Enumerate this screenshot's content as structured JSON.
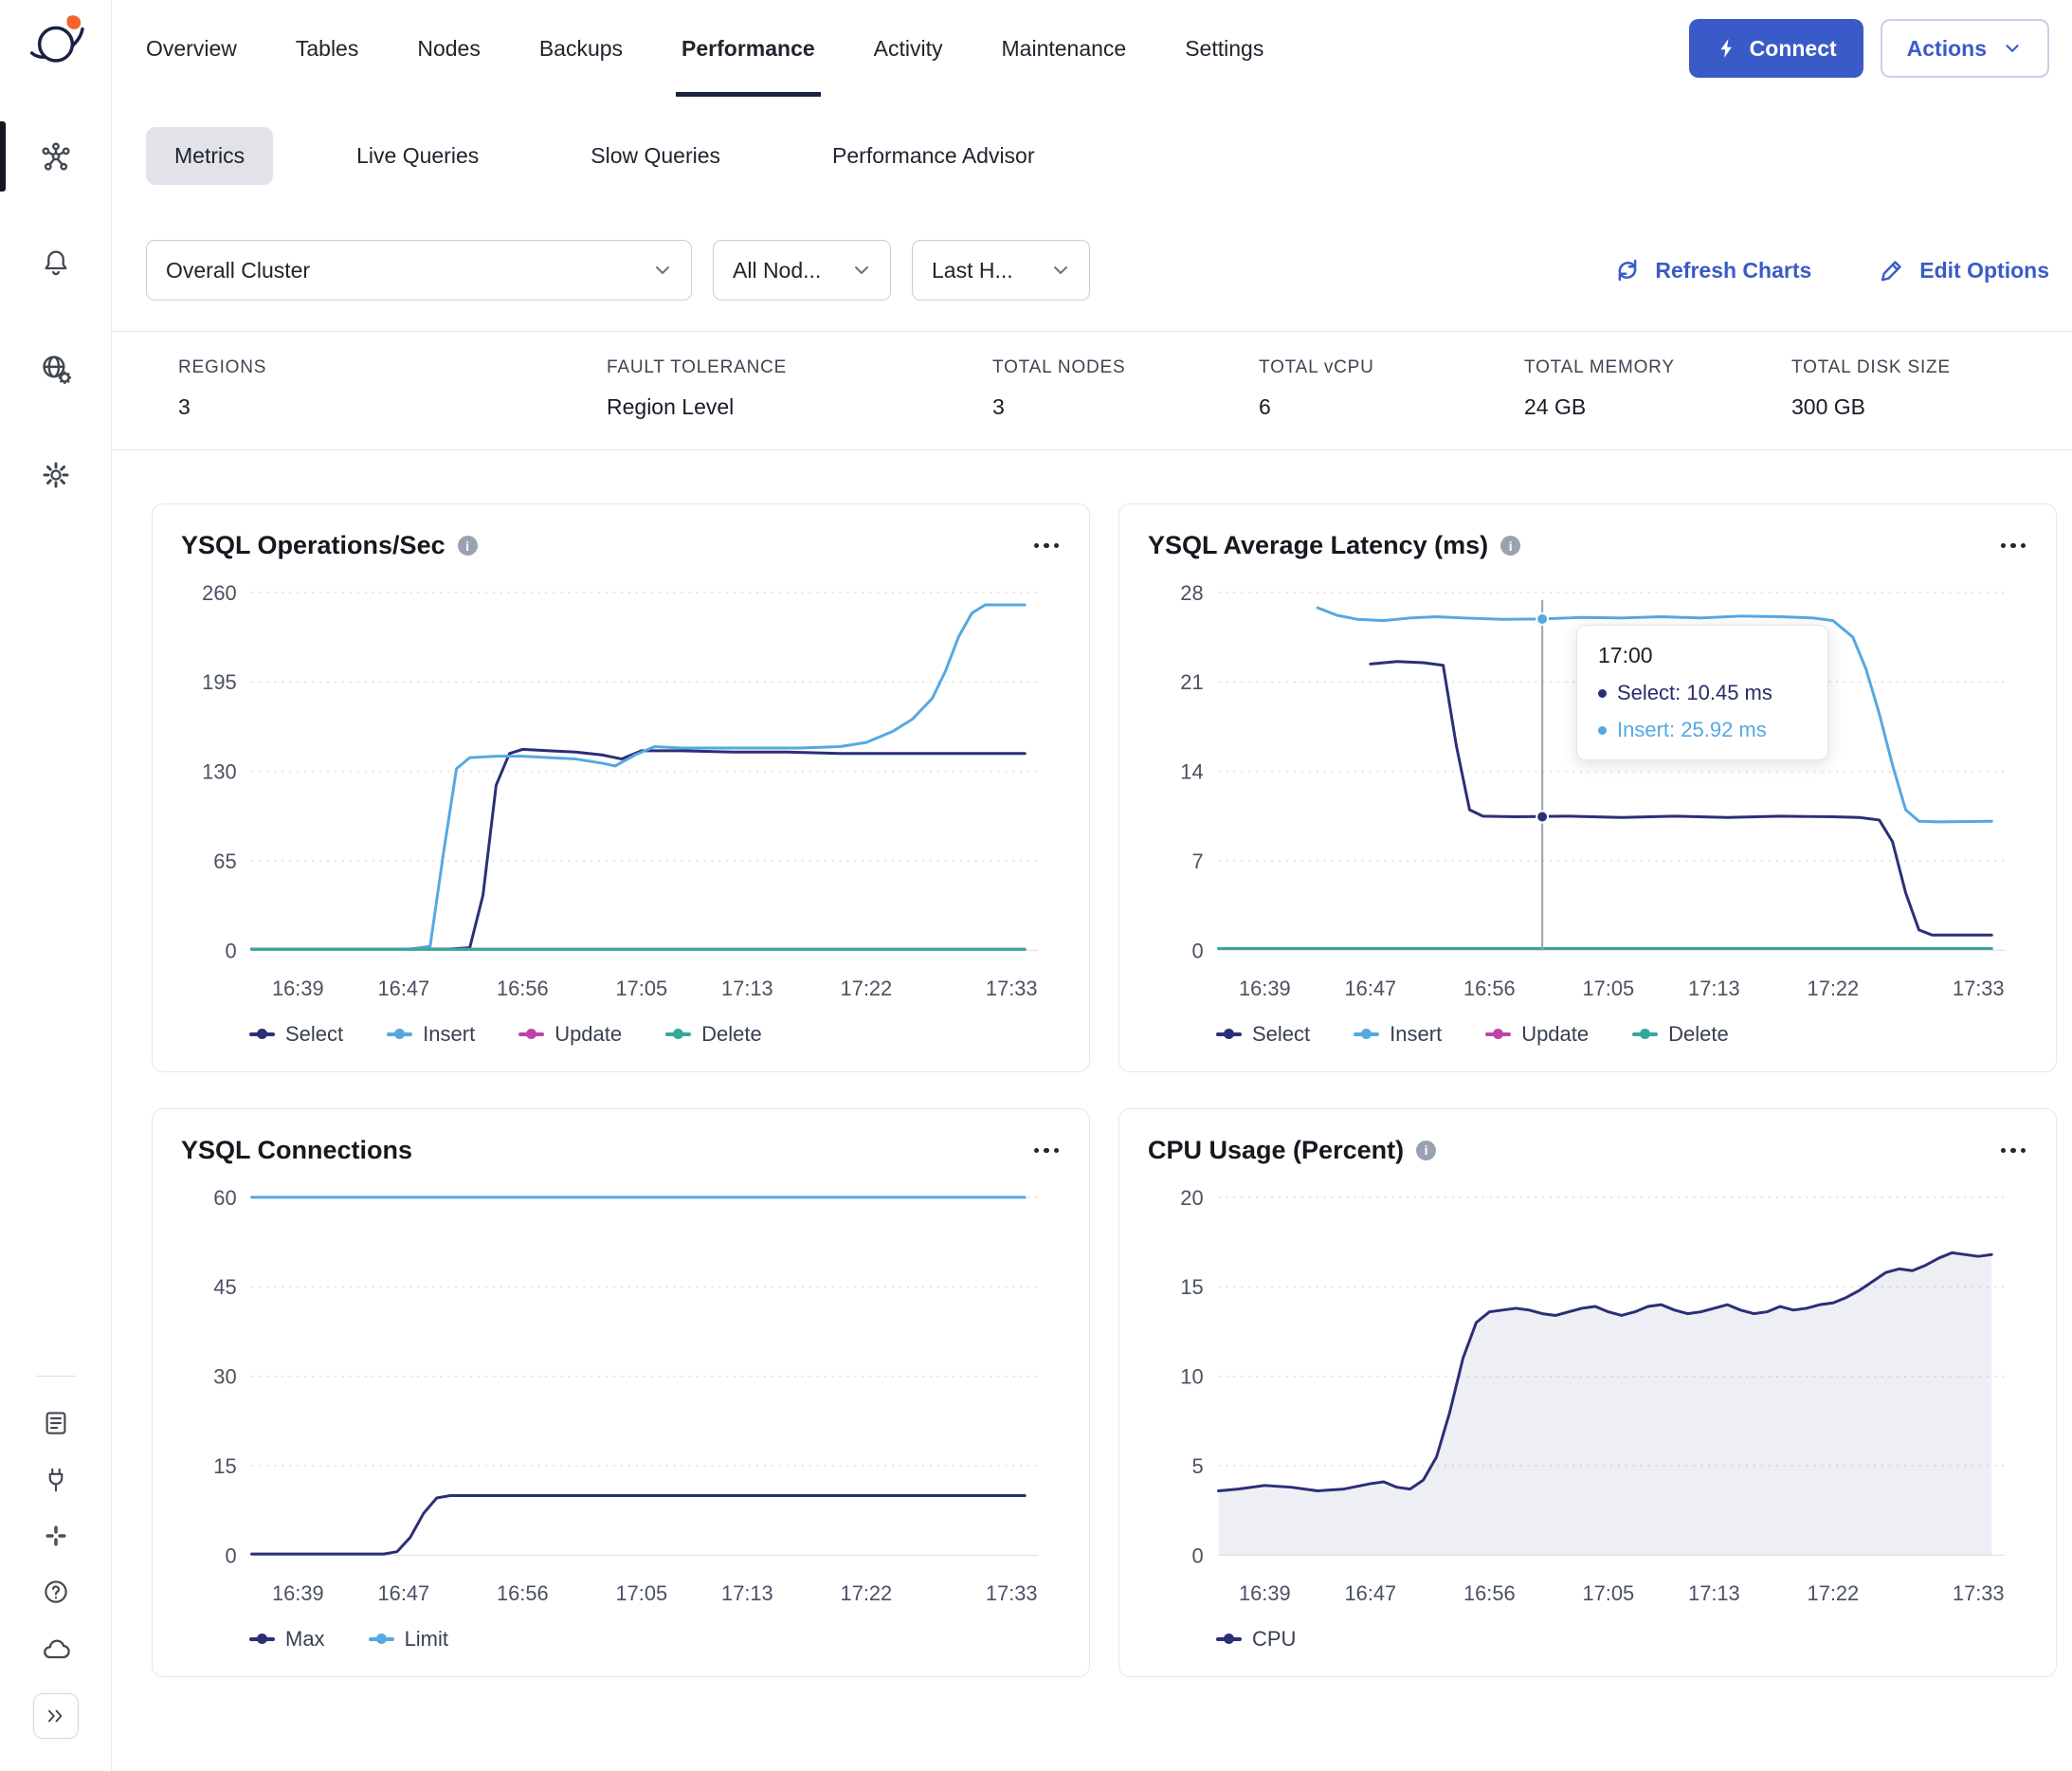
{
  "colors": {
    "accent": "#3A5BC7",
    "select": "#2B2F77",
    "insert": "#55A8E2",
    "update": "#BE44A6",
    "delete": "#35A89E",
    "underline": "#1C2340"
  },
  "header": {
    "tabs": [
      "Overview",
      "Tables",
      "Nodes",
      "Backups",
      "Performance",
      "Activity",
      "Maintenance",
      "Settings"
    ],
    "active_tab": "Performance",
    "connect_label": "Connect",
    "actions_label": "Actions"
  },
  "subtabs": [
    "Metrics",
    "Live Queries",
    "Slow Queries",
    "Performance Advisor"
  ],
  "filters": {
    "cluster_select": "Overall Cluster",
    "nodes_select": "All Nod...",
    "time_select": "Last H...",
    "refresh_label": "Refresh Charts",
    "edit_label": "Edit Options"
  },
  "stats": [
    {
      "label": "REGIONS",
      "value": "3"
    },
    {
      "label": "FAULT TOLERANCE",
      "value": "Region Level"
    },
    {
      "label": "TOTAL NODES",
      "value": "3"
    },
    {
      "label": "TOTAL vCPU",
      "value": "6"
    },
    {
      "label": "TOTAL MEMORY",
      "value": "24 GB"
    },
    {
      "label": "TOTAL DISK SIZE",
      "value": "300 GB"
    }
  ],
  "tooltip": {
    "time": "17:00",
    "rows": [
      {
        "label": "Select: 10.45 ms"
      },
      {
        "label": "Insert: 25.92 ms"
      }
    ]
  },
  "chart_data": [
    {
      "id": "ops",
      "type": "line",
      "title": "YSQL Operations/Sec",
      "xlim": [
        995.5,
        1055
      ],
      "ylim": [
        0,
        260
      ],
      "yticks": [
        0,
        65,
        130,
        195,
        260
      ],
      "xticks": [
        {
          "t": 999,
          "label": "16:39"
        },
        {
          "t": 1007,
          "label": "16:47"
        },
        {
          "t": 1016,
          "label": "16:56"
        },
        {
          "t": 1025,
          "label": "17:05"
        },
        {
          "t": 1033,
          "label": "17:13"
        },
        {
          "t": 1042,
          "label": "17:22"
        },
        {
          "t": 1053,
          "label": "17:33"
        }
      ],
      "series": [
        {
          "name": "Select",
          "color": "#2B2F77",
          "points": [
            [
              995.5,
              1
            ],
            [
              1010.5,
              1
            ],
            [
              1012,
              2
            ],
            [
              1013,
              40
            ],
            [
              1014,
              120
            ],
            [
              1015,
              143
            ],
            [
              1016,
              146
            ],
            [
              1018,
              145
            ],
            [
              1020,
              144
            ],
            [
              1022,
              142
            ],
            [
              1023.5,
              139
            ],
            [
              1025,
              145
            ],
            [
              1028,
              145
            ],
            [
              1032,
              144
            ],
            [
              1036,
              144
            ],
            [
              1040,
              143
            ],
            [
              1044,
              143
            ],
            [
              1048,
              143
            ],
            [
              1051,
              143
            ],
            [
              1054,
              143
            ]
          ]
        },
        {
          "name": "Insert",
          "color": "#55A8E2",
          "points": [
            [
              995.5,
              1
            ],
            [
              1007.5,
              1
            ],
            [
              1009,
              3
            ],
            [
              1010,
              70
            ],
            [
              1011,
              132
            ],
            [
              1012,
              140
            ],
            [
              1014,
              141
            ],
            [
              1016,
              141
            ],
            [
              1018,
              140
            ],
            [
              1020,
              139
            ],
            [
              1022,
              136
            ],
            [
              1023,
              134
            ],
            [
              1024.5,
              142
            ],
            [
              1026,
              148
            ],
            [
              1028,
              147
            ],
            [
              1031,
              147
            ],
            [
              1034,
              147
            ],
            [
              1037,
              147
            ],
            [
              1040,
              148
            ],
            [
              1042,
              151
            ],
            [
              1044,
              159
            ],
            [
              1045.5,
              168
            ],
            [
              1047,
              183
            ],
            [
              1048,
              203
            ],
            [
              1049,
              228
            ],
            [
              1050,
              245
            ],
            [
              1051,
              251
            ],
            [
              1054,
              251
            ]
          ]
        },
        {
          "name": "Update",
          "color": "#BE44A6",
          "points": [
            [
              995.5,
              0.8
            ],
            [
              1054,
              0.8
            ]
          ]
        },
        {
          "name": "Delete",
          "color": "#35A89E",
          "points": [
            [
              995.5,
              0.8
            ],
            [
              1054,
              0.8
            ]
          ]
        }
      ]
    },
    {
      "id": "latency",
      "type": "line",
      "title": "YSQL Average Latency (ms)",
      "xlim": [
        995.5,
        1055
      ],
      "ylim": [
        0,
        28
      ],
      "yticks": [
        0,
        7,
        14,
        21,
        28
      ],
      "xticks": [
        {
          "t": 999,
          "label": "16:39"
        },
        {
          "t": 1007,
          "label": "16:47"
        },
        {
          "t": 1016,
          "label": "16:56"
        },
        {
          "t": 1025,
          "label": "17:05"
        },
        {
          "t": 1033,
          "label": "17:13"
        },
        {
          "t": 1042,
          "label": "17:22"
        },
        {
          "t": 1053,
          "label": "17:33"
        }
      ],
      "cursor": {
        "t": 1020,
        "label": "17:00",
        "markers": [
          {
            "v": 25.92,
            "color": "#55A8E2"
          },
          {
            "v": 10.45,
            "color": "#2B2F77"
          }
        ]
      },
      "series": [
        {
          "name": "Select",
          "color": "#2B2F77",
          "points": [
            [
              1007,
              22.4
            ],
            [
              1009,
              22.6
            ],
            [
              1011,
              22.5
            ],
            [
              1012.5,
              22.3
            ],
            [
              1013.5,
              16
            ],
            [
              1014.5,
              11
            ],
            [
              1015.5,
              10.5
            ],
            [
              1018,
              10.45
            ],
            [
              1022,
              10.5
            ],
            [
              1026,
              10.4
            ],
            [
              1030,
              10.5
            ],
            [
              1034,
              10.4
            ],
            [
              1038,
              10.5
            ],
            [
              1042,
              10.45
            ],
            [
              1044,
              10.4
            ],
            [
              1045.5,
              10.2
            ],
            [
              1046.5,
              8.5
            ],
            [
              1047.5,
              4.5
            ],
            [
              1048.5,
              1.6
            ],
            [
              1049.5,
              1.2
            ],
            [
              1054,
              1.2
            ]
          ]
        },
        {
          "name": "Insert",
          "color": "#55A8E2",
          "points": [
            [
              1003,
              26.8
            ],
            [
              1004.5,
              26.2
            ],
            [
              1006,
              25.9
            ],
            [
              1008,
              25.8
            ],
            [
              1010,
              26
            ],
            [
              1012,
              26.1
            ],
            [
              1014,
              26
            ],
            [
              1017,
              25.9
            ],
            [
              1020,
              25.92
            ],
            [
              1023,
              26.05
            ],
            [
              1026,
              26
            ],
            [
              1029,
              26.1
            ],
            [
              1032,
              26
            ],
            [
              1035,
              26.15
            ],
            [
              1038,
              26.1
            ],
            [
              1040.5,
              26
            ],
            [
              1042,
              25.8
            ],
            [
              1043.5,
              24.5
            ],
            [
              1044.5,
              22
            ],
            [
              1045.5,
              18.5
            ],
            [
              1046.5,
              14.5
            ],
            [
              1047.5,
              11
            ],
            [
              1048.5,
              10.1
            ],
            [
              1050,
              10.05
            ],
            [
              1054,
              10.1
            ]
          ]
        },
        {
          "name": "Update",
          "color": "#BE44A6",
          "points": [
            [
              995.5,
              0.15
            ],
            [
              1054,
              0.15
            ]
          ]
        },
        {
          "name": "Delete",
          "color": "#35A89E",
          "points": [
            [
              995.5,
              0.15
            ],
            [
              1054,
              0.15
            ]
          ]
        }
      ]
    },
    {
      "id": "conns",
      "type": "line",
      "title": "YSQL Connections",
      "xlim": [
        995.5,
        1055
      ],
      "ylim": [
        0,
        60
      ],
      "yticks": [
        0,
        15,
        30,
        45,
        60
      ],
      "xticks": [
        {
          "t": 999,
          "label": "16:39"
        },
        {
          "t": 1007,
          "label": "16:47"
        },
        {
          "t": 1016,
          "label": "16:56"
        },
        {
          "t": 1025,
          "label": "17:05"
        },
        {
          "t": 1033,
          "label": "17:13"
        },
        {
          "t": 1042,
          "label": "17:22"
        },
        {
          "t": 1053,
          "label": "17:33"
        }
      ],
      "series": [
        {
          "name": "Max",
          "color": "#2B2F77",
          "points": [
            [
              995.5,
              0.2
            ],
            [
              1005.5,
              0.2
            ],
            [
              1006.5,
              0.6
            ],
            [
              1007.5,
              3
            ],
            [
              1008.5,
              7
            ],
            [
              1009.5,
              9.6
            ],
            [
              1010.5,
              10
            ],
            [
              1054,
              10
            ]
          ]
        },
        {
          "name": "Limit",
          "color": "#55A8E2",
          "points": [
            [
              995.5,
              60
            ],
            [
              1054,
              60
            ]
          ]
        }
      ]
    },
    {
      "id": "cpu",
      "type": "area",
      "title": "CPU Usage (Percent)",
      "xlim": [
        995.5,
        1055
      ],
      "ylim": [
        0,
        20
      ],
      "yticks": [
        0,
        5,
        10,
        15,
        20
      ],
      "xticks": [
        {
          "t": 999,
          "label": "16:39"
        },
        {
          "t": 1007,
          "label": "16:47"
        },
        {
          "t": 1016,
          "label": "16:56"
        },
        {
          "t": 1025,
          "label": "17:05"
        },
        {
          "t": 1033,
          "label": "17:13"
        },
        {
          "t": 1042,
          "label": "17:22"
        },
        {
          "t": 1053,
          "label": "17:33"
        }
      ],
      "series": [
        {
          "name": "CPU",
          "color": "#2B2F77",
          "area": true,
          "points": [
            [
              995.5,
              3.6
            ],
            [
              997,
              3.7
            ],
            [
              999,
              3.9
            ],
            [
              1001,
              3.8
            ],
            [
              1003,
              3.6
            ],
            [
              1005,
              3.7
            ],
            [
              1007,
              4.0
            ],
            [
              1008,
              4.1
            ],
            [
              1009,
              3.8
            ],
            [
              1010,
              3.7
            ],
            [
              1011,
              4.2
            ],
            [
              1012,
              5.5
            ],
            [
              1013,
              8
            ],
            [
              1014,
              11
            ],
            [
              1015,
              13
            ],
            [
              1016,
              13.6
            ],
            [
              1017,
              13.7
            ],
            [
              1018,
              13.8
            ],
            [
              1019,
              13.7
            ],
            [
              1020,
              13.5
            ],
            [
              1021,
              13.4
            ],
            [
              1022,
              13.6
            ],
            [
              1023,
              13.8
            ],
            [
              1024,
              13.9
            ],
            [
              1025,
              13.6
            ],
            [
              1026,
              13.4
            ],
            [
              1027,
              13.6
            ],
            [
              1028,
              13.9
            ],
            [
              1029,
              14
            ],
            [
              1030,
              13.7
            ],
            [
              1031,
              13.5
            ],
            [
              1032,
              13.6
            ],
            [
              1033,
              13.8
            ],
            [
              1034,
              14
            ],
            [
              1035,
              13.7
            ],
            [
              1036,
              13.5
            ],
            [
              1037,
              13.6
            ],
            [
              1038,
              13.9
            ],
            [
              1039,
              13.7
            ],
            [
              1040,
              13.8
            ],
            [
              1041,
              14
            ],
            [
              1042,
              14.1
            ],
            [
              1043,
              14.4
            ],
            [
              1044,
              14.8
            ],
            [
              1045,
              15.3
            ],
            [
              1046,
              15.8
            ],
            [
              1047,
              16
            ],
            [
              1048,
              15.9
            ],
            [
              1049,
              16.2
            ],
            [
              1050,
              16.6
            ],
            [
              1051,
              16.9
            ],
            [
              1052,
              16.8
            ],
            [
              1053,
              16.7
            ],
            [
              1054,
              16.8
            ]
          ]
        }
      ]
    }
  ]
}
